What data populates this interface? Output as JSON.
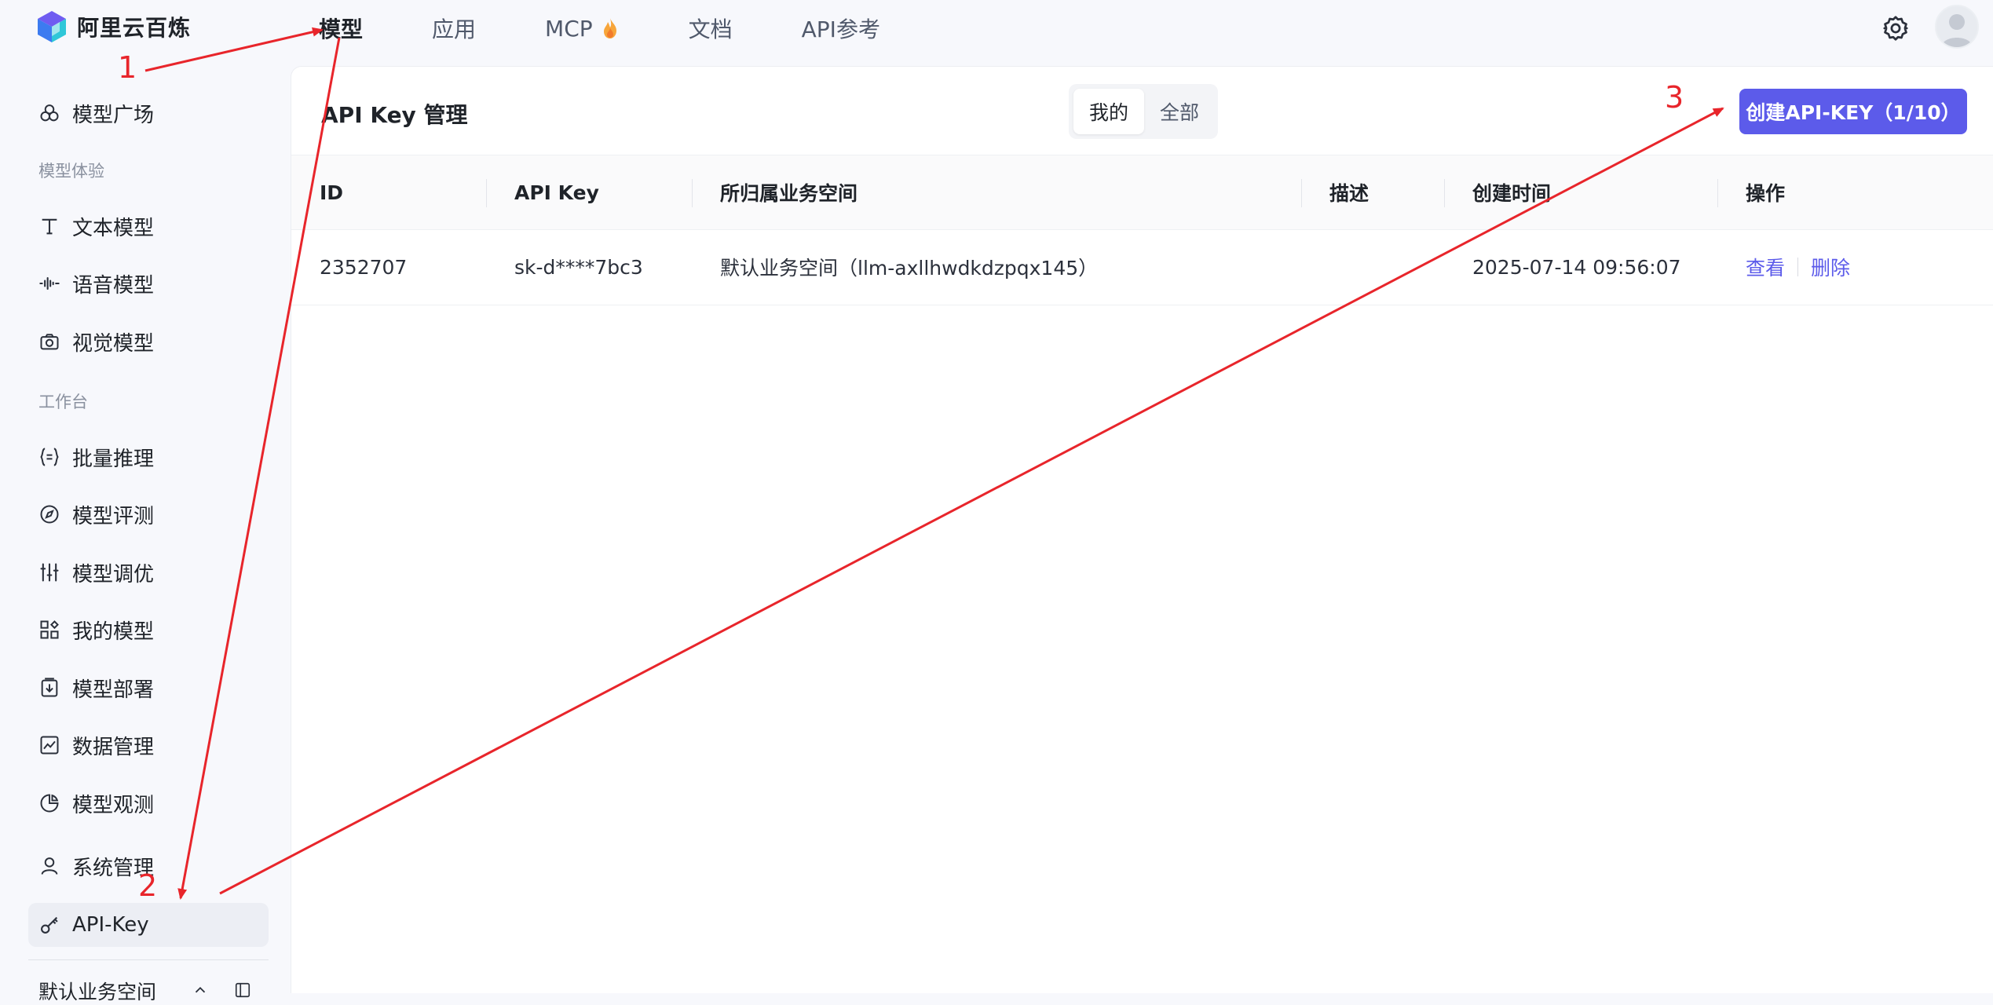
{
  "app": {
    "name": "阿里云百炼"
  },
  "nav": {
    "items": [
      {
        "label": "模型",
        "active": true
      },
      {
        "label": "应用"
      },
      {
        "label": "MCP",
        "icon": "fire-icon"
      },
      {
        "label": "文档"
      },
      {
        "label": "API参考"
      }
    ]
  },
  "sidebar": {
    "top_item": {
      "label": "模型广场",
      "icon": "model-square-icon"
    },
    "group1": "模型体验",
    "experience": [
      {
        "label": "文本模型",
        "icon": "text-icon"
      },
      {
        "label": "语音模型",
        "icon": "audio-wave-icon"
      },
      {
        "label": "视觉模型",
        "icon": "camera-icon"
      }
    ],
    "group2": "工作台",
    "workbench": [
      {
        "label": "批量推理",
        "icon": "braces-icon"
      },
      {
        "label": "模型评测",
        "icon": "compass-icon"
      },
      {
        "label": "模型调优",
        "icon": "sliders-icon"
      },
      {
        "label": "我的模型",
        "icon": "grid-icon"
      },
      {
        "label": "模型部署",
        "icon": "deploy-icon"
      },
      {
        "label": "数据管理",
        "icon": "chart-icon"
      },
      {
        "label": "模型观测",
        "icon": "pie-icon"
      }
    ],
    "system": {
      "label": "系统管理",
      "icon": "user-icon"
    },
    "apikey": {
      "label": "API-Key",
      "icon": "key-icon"
    },
    "bottom_workspace": "默认业务空间"
  },
  "main": {
    "title": "API Key 管理",
    "segment": {
      "mine": "我的",
      "all": "全部",
      "selected": "我的"
    },
    "create_button": "创建API-KEY（1/10）",
    "table": {
      "headers": [
        "ID",
        "API Key",
        "所归属业务空间",
        "描述",
        "创建时间",
        "操作"
      ],
      "rows": [
        {
          "id": "2352707",
          "api_key": "sk-d****7bc3",
          "workspace": "默认业务空间（llm-axllhwdkdzpqx145）",
          "description": "",
          "created": "2025-07-14 09:56:07",
          "view": "查看",
          "delete": "删除"
        }
      ]
    }
  },
  "annotations": {
    "n1": "1",
    "n2": "2",
    "n3": "3",
    "color": "#e8252b"
  },
  "colors": {
    "accent": "#5c5bea",
    "background": "#f7f8fc"
  }
}
